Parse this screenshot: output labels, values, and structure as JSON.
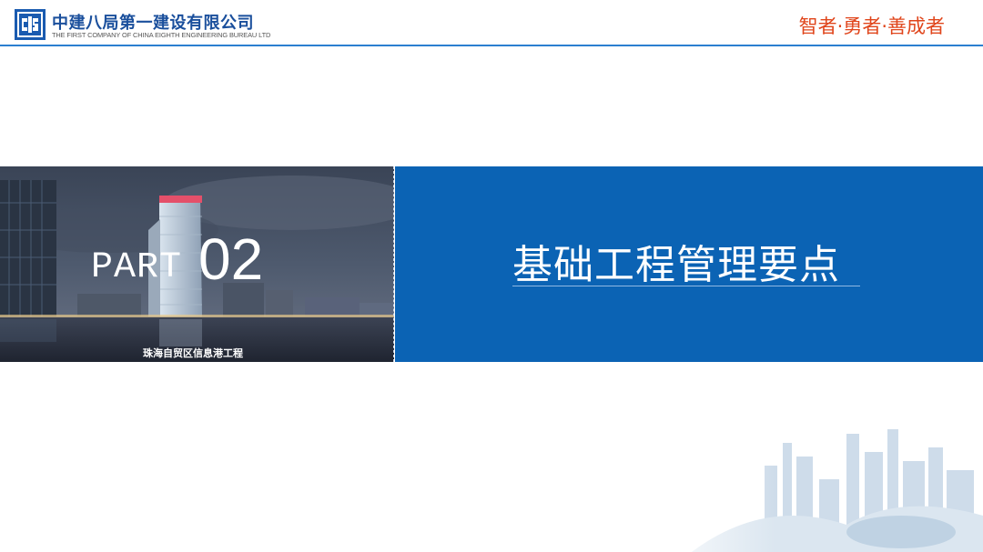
{
  "header": {
    "company_name_cn": "中建八局第一建设有限公司",
    "company_name_en": "THE FIRST COMPANY OF CHINA EIGHTH ENGINEERING BUREAU LTD",
    "slogan": "智者·勇者·善成者",
    "logo_icon": "cscec-logo-icon"
  },
  "section": {
    "part_label": "PART",
    "part_number": "02",
    "title": "基础工程管理要点",
    "photo_caption": "珠海自贸区信息港工程"
  },
  "colors": {
    "brand_blue": "#0b63b4",
    "header_line": "#2b7fd0",
    "slogan_orange": "#e0451b",
    "company_text": "#1a4f9c"
  }
}
